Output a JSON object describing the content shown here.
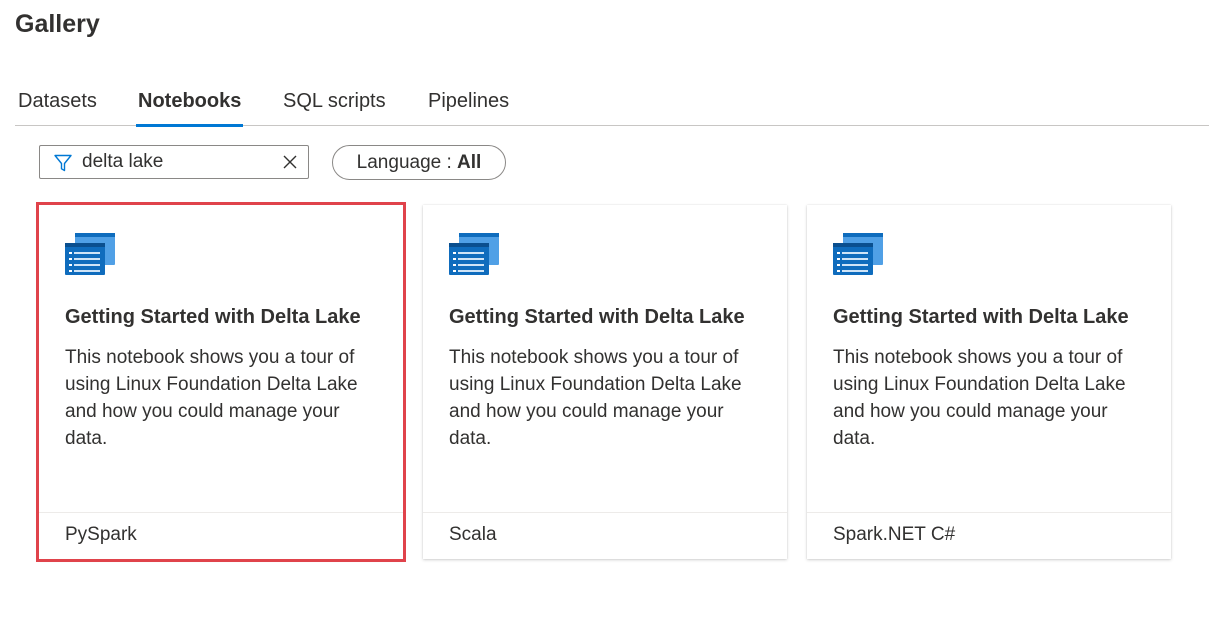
{
  "page": {
    "title": "Gallery"
  },
  "tabs": [
    {
      "label": "Datasets",
      "active": false
    },
    {
      "label": "Notebooks",
      "active": true
    },
    {
      "label": "SQL scripts",
      "active": false
    },
    {
      "label": "Pipelines",
      "active": false
    }
  ],
  "filter": {
    "icon": "filter-icon",
    "value": "delta lake",
    "clear_icon": "close-icon"
  },
  "language_filter": {
    "label": "Language : ",
    "value": "All"
  },
  "colors": {
    "accent": "#0078d4",
    "selection_outline": "#e0434b",
    "icon_primary": "#0f6cbd",
    "icon_secondary": "#50a0e6"
  },
  "cards": [
    {
      "icon": "notebook-icon",
      "title": "Getting Started with Delta Lake",
      "description": "This notebook shows you a tour of using Linux Foundation Delta Lake and how you could manage your data.",
      "language": "PySpark",
      "selected": true
    },
    {
      "icon": "notebook-icon",
      "title": "Getting Started with Delta Lake",
      "description": "This notebook shows you a tour of using Linux Foundation Delta Lake and how you could manage your data.",
      "language": "Scala",
      "selected": false
    },
    {
      "icon": "notebook-icon",
      "title": "Getting Started with Delta Lake",
      "description": "This notebook shows you a tour of using Linux Foundation Delta Lake and how you could manage your data.",
      "language": "Spark.NET C#",
      "selected": false
    }
  ]
}
